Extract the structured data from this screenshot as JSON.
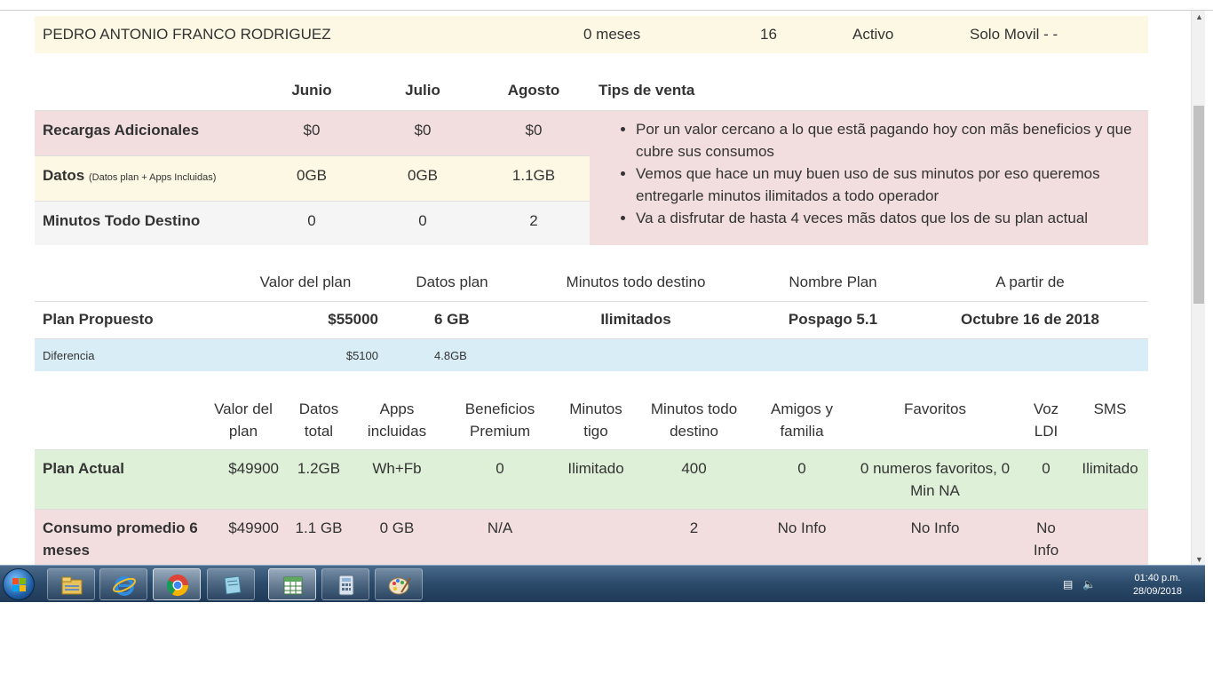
{
  "customer": {
    "name": "PEDRO ANTONIO FRANCO RODRIGUEZ",
    "antiguedad": "0 meses",
    "numero": "16",
    "estado": "Activo",
    "tipo": "Solo Movil - -"
  },
  "consumo": {
    "months": [
      "Junio",
      "Julio",
      "Agosto"
    ],
    "tips_title": "Tips de venta",
    "rows": [
      {
        "label": "Recargas Adicionales",
        "sub": "",
        "values": [
          "$0",
          "$0",
          "$0"
        ]
      },
      {
        "label": "Datos",
        "sub": "(Datos plan + Apps Incluidas)",
        "values": [
          "0GB",
          "0GB",
          "1.1GB"
        ]
      },
      {
        "label": "Minutos Todo Destino",
        "sub": "",
        "values": [
          "0",
          "0",
          "2"
        ]
      }
    ],
    "tips": [
      "Por un valor cercano a lo que estã pagando hoy con mãs beneficios y que cubre sus consumos",
      "Vemos que hace un muy buen uso de sus minutos por eso queremos entregarle minutos ilimitados a todo operador",
      "Va a disfrutar de hasta 4 veces mãs datos que los de su plan actual"
    ]
  },
  "propuesto": {
    "headers": [
      "Valor del plan",
      "Datos plan",
      "Minutos todo destino",
      "Nombre Plan",
      "A partir de"
    ],
    "row": {
      "label": "Plan Propuesto",
      "valor": "$55000",
      "datos": "6 GB",
      "minutos": "Ilimitados",
      "nombre": "Pospago 5.1",
      "fecha": "Octubre 16 de 2018"
    },
    "diferencia": {
      "label": "Diferencia",
      "valor": "$5100",
      "datos": "4.8GB"
    }
  },
  "actual": {
    "headers": [
      "Valor del plan",
      "Datos total",
      "Apps incluidas",
      "Beneficios Premium",
      "Minutos tigo",
      "Minutos todo destino",
      "Amigos y familia",
      "Favoritos",
      "Voz LDI",
      "SMS"
    ],
    "plan": {
      "label": "Plan Actual",
      "values": [
        "$49900",
        "1.2GB",
        "Wh+Fb",
        "0",
        "Ilimitado",
        "400",
        "0",
        "0 numeros favoritos, 0 Min NA",
        "0",
        "Ilimitado"
      ]
    },
    "consumo": {
      "label": "Consumo promedio 6 meses",
      "values": [
        "$49900",
        "1.1 GB",
        "0 GB",
        "N/A",
        "",
        "2",
        "No Info",
        "No Info",
        "No Info",
        ""
      ]
    }
  },
  "taskbar": {
    "apps": [
      "windows-explorer",
      "internet-explorer",
      "google-chrome",
      "notebook-app",
      "spreadsheet-app",
      "calculator",
      "paint"
    ],
    "time": "01:40 p.m.",
    "date": "28/09/2018"
  }
}
